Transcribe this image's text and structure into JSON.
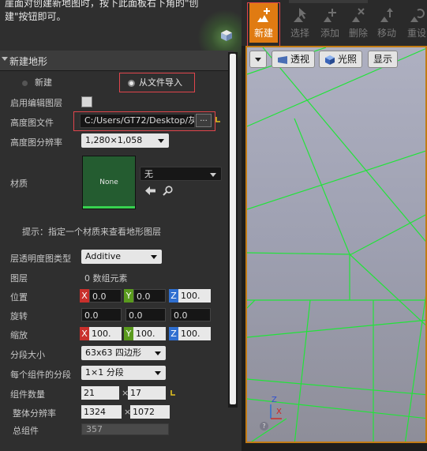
{
  "top_hint": "崖面对创建新地图时，按下此面板右下角的\"创建\"按钮即可。",
  "section_title": "新建地形",
  "radio_new": "新建",
  "radio_import": "从文件导入",
  "labels": {
    "enable_edit_layers": "启用编辑图层",
    "heightmap_file": "高度图文件",
    "heightmap_resolution": "高度图分辨率",
    "material": "材质",
    "layer_blend_type": "层透明度图类型",
    "layers": "图层",
    "location": "位置",
    "rotation": "旋转",
    "scale": "缩放",
    "section_size": "分段大小",
    "sections_per_component": "每个组件的分段",
    "component_count": "组件数量",
    "overall_resolution": "整体分辨率",
    "total_components": "总组件"
  },
  "heightmap_path": "C:/Users/GT72/Desktop/灰",
  "browse_label": "...",
  "resolution_value": "1,280×1,058",
  "material_thumb": "None",
  "material_value": "无",
  "material_tip": "提示：指定一个材质来查看地形图层",
  "blend_type": "Additive",
  "layers_value": "0 数组元素",
  "location": {
    "x": "0.0",
    "y": "0.0",
    "z": "100."
  },
  "rotation": {
    "x": "0.0",
    "y": "0.0",
    "z": "0.0"
  },
  "scale": {
    "x": "100.",
    "y": "100.",
    "z": "100."
  },
  "axis_tags": {
    "x": "X",
    "y": "Y",
    "z": "Z"
  },
  "section_size_value": "63x63 四边形",
  "sections_per_component_value": "1×1 分段",
  "component_count": {
    "x": "21",
    "y": "17"
  },
  "overall_resolution": {
    "x": "1324",
    "y": "1072"
  },
  "times": "×",
  "total_components_value": "357",
  "toolbar": [
    {
      "label": "新建",
      "icon": "new-icon",
      "active": true
    },
    {
      "label": "选择",
      "icon": "select-icon",
      "active": false
    },
    {
      "label": "添加",
      "icon": "add-icon",
      "active": false
    },
    {
      "label": "删除",
      "icon": "delete-icon",
      "active": false
    },
    {
      "label": "移动",
      "icon": "move-icon",
      "active": false
    },
    {
      "label": "重设",
      "icon": "reset-icon",
      "active": false
    }
  ],
  "viewport": {
    "perspective_label": "透视",
    "lit_label": "光照",
    "show_label": "显示",
    "axis_z": "Z",
    "axis_x": "X"
  },
  "colors": {
    "accent": "#e07b12",
    "highlight_box": "#e0454c",
    "grid_line": "#22e33a",
    "material_bar": "#37d24f"
  }
}
